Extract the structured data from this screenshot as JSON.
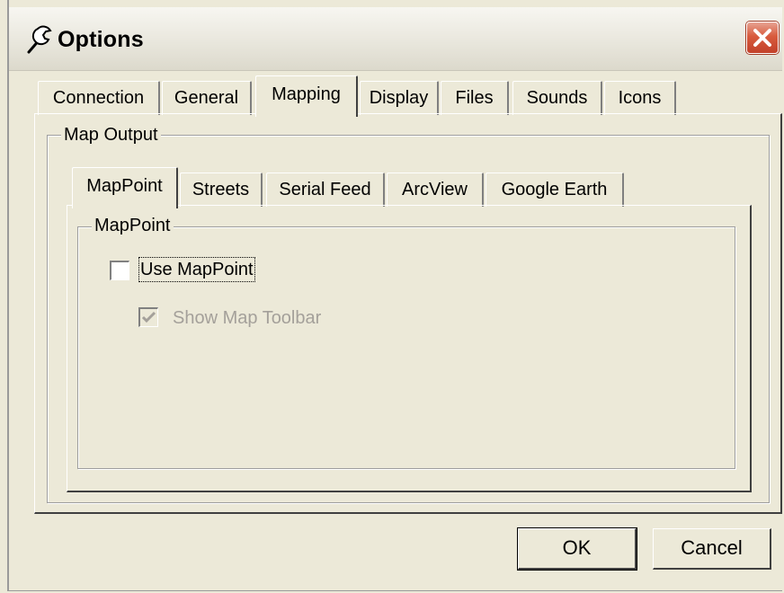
{
  "window": {
    "title": "Options",
    "icon": "wrench-icon",
    "close_icon": "close-icon"
  },
  "tabs": [
    {
      "label": "Connection",
      "selected": false
    },
    {
      "label": "General",
      "selected": false
    },
    {
      "label": "Mapping",
      "selected": true
    },
    {
      "label": "Display",
      "selected": false
    },
    {
      "label": "Files",
      "selected": false
    },
    {
      "label": "Sounds",
      "selected": false
    },
    {
      "label": "Icons",
      "selected": false
    }
  ],
  "map_output": {
    "label": "Map Output",
    "tabs": [
      {
        "label": "MapPoint",
        "selected": true
      },
      {
        "label": "Streets",
        "selected": false
      },
      {
        "label": "Serial Feed",
        "selected": false
      },
      {
        "label": "ArcView",
        "selected": false
      },
      {
        "label": "Google Earth",
        "selected": false
      }
    ],
    "mappoint_group": {
      "label": "MapPoint",
      "use_mappoint": {
        "label": "Use MapPoint",
        "checked": false,
        "enabled": true
      },
      "show_toolbar": {
        "label": "Show Map Toolbar",
        "checked": true,
        "enabled": false
      }
    }
  },
  "buttons": {
    "ok": "OK",
    "cancel": "Cancel"
  },
  "colors": {
    "face": "#ece9d8",
    "close_red": "#d85b3e",
    "disabled_text": "#a4a09a"
  }
}
